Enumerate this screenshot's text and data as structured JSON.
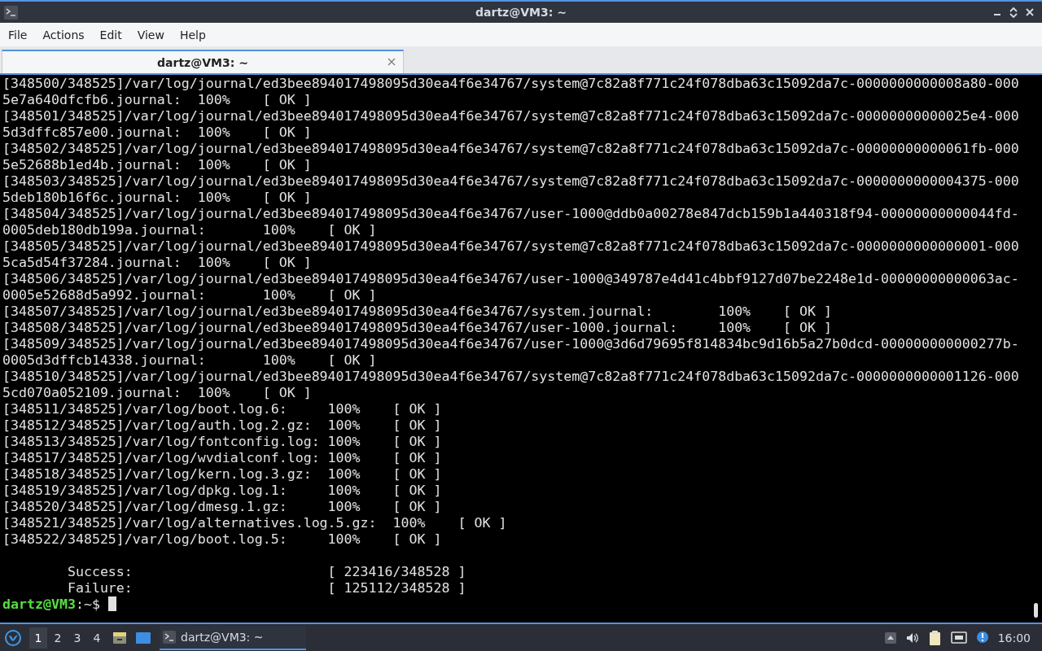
{
  "window": {
    "title": "dartz@VM3: ~"
  },
  "menu": [
    "File",
    "Actions",
    "Edit",
    "View",
    "Help"
  ],
  "tabs": [
    {
      "label": "dartz@VM3: ~",
      "selected": true
    }
  ],
  "terminal": {
    "lines": [
      "[348500/348525]/var/log/journal/ed3bee894017498095d30ea4f6e34767/system@7c82a8f771c24f078dba63c15092da7c-0000000000008a80-000",
      "5e7a640dfcfb6.journal:  100%    [ OK ]",
      "[348501/348525]/var/log/journal/ed3bee894017498095d30ea4f6e34767/system@7c82a8f771c24f078dba63c15092da7c-00000000000025e4-000",
      "5d3dffc857e00.journal:  100%    [ OK ]",
      "[348502/348525]/var/log/journal/ed3bee894017498095d30ea4f6e34767/system@7c82a8f771c24f078dba63c15092da7c-00000000000061fb-000",
      "5e52688b1ed4b.journal:  100%    [ OK ]",
      "[348503/348525]/var/log/journal/ed3bee894017498095d30ea4f6e34767/system@7c82a8f771c24f078dba63c15092da7c-0000000000004375-000",
      "5deb180b16f6c.journal:  100%    [ OK ]",
      "[348504/348525]/var/log/journal/ed3bee894017498095d30ea4f6e34767/user-1000@ddb0a00278e847dcb159b1a440318f94-00000000000044fd-",
      "0005deb180db199a.journal:       100%    [ OK ]",
      "[348505/348525]/var/log/journal/ed3bee894017498095d30ea4f6e34767/system@7c82a8f771c24f078dba63c15092da7c-0000000000000001-000",
      "5ca5d54f37284.journal:  100%    [ OK ]",
      "[348506/348525]/var/log/journal/ed3bee894017498095d30ea4f6e34767/user-1000@349787e4d41c4bbf9127d07be2248e1d-00000000000063ac-",
      "0005e52688d5a992.journal:       100%    [ OK ]",
      "[348507/348525]/var/log/journal/ed3bee894017498095d30ea4f6e34767/system.journal:        100%    [ OK ]",
      "[348508/348525]/var/log/journal/ed3bee894017498095d30ea4f6e34767/user-1000.journal:     100%    [ OK ]",
      "[348509/348525]/var/log/journal/ed3bee894017498095d30ea4f6e34767/user-1000@3d6d79695f814834bc9d16b5a27b0dcd-000000000000277b-",
      "0005d3dffcb14338.journal:       100%    [ OK ]",
      "[348510/348525]/var/log/journal/ed3bee894017498095d30ea4f6e34767/system@7c82a8f771c24f078dba63c15092da7c-0000000000001126-000",
      "5cd070a052109.journal:  100%    [ OK ]",
      "[348511/348525]/var/log/boot.log.6:     100%    [ OK ]",
      "[348512/348525]/var/log/auth.log.2.gz:  100%    [ OK ]",
      "[348513/348525]/var/log/fontconfig.log: 100%    [ OK ]",
      "[348517/348525]/var/log/wvdialconf.log: 100%    [ OK ]",
      "[348518/348525]/var/log/kern.log.3.gz:  100%    [ OK ]",
      "[348519/348525]/var/log/dpkg.log.1:     100%    [ OK ]",
      "[348520/348525]/var/log/dmesg.1.gz:     100%    [ OK ]",
      "[348521/348525]/var/log/alternatives.log.5.gz:  100%    [ OK ]",
      "[348522/348525]/var/log/boot.log.5:     100%    [ OK ]"
    ],
    "summary": [
      "        Success:                        [ 223416/348528 ]",
      "        Failure:                        [ 125112/348528 ]"
    ],
    "prompt": {
      "user_host": "dartz@VM3",
      "rest": ":~$"
    }
  },
  "taskbar": {
    "workspaces": [
      {
        "label": "1",
        "selected": true
      },
      {
        "label": "2",
        "selected": false
      },
      {
        "label": "3",
        "selected": false
      },
      {
        "label": "4",
        "selected": false
      }
    ],
    "tasks": [
      {
        "label": "dartz@VM3: ~",
        "selected": true
      }
    ],
    "clock": "16:00"
  }
}
